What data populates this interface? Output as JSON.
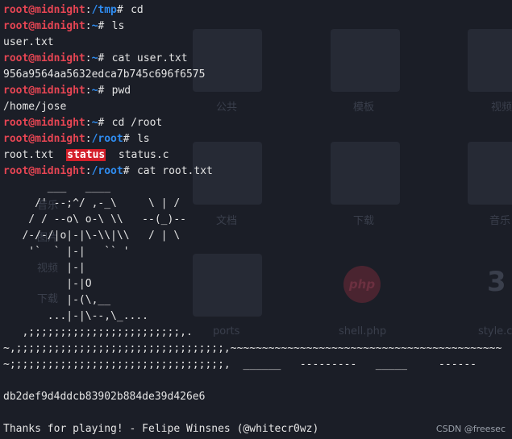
{
  "prompt": {
    "user": "root@midnight",
    "colon": ":",
    "symbol": "#"
  },
  "paths": {
    "tmp": "/tmp",
    "home": "~",
    "root": "/root"
  },
  "commands": {
    "cd": "cd",
    "ls": "ls",
    "cat_user": "cat user.txt",
    "pwd": "pwd",
    "cd_root": "cd /root",
    "cat_root": "cat root.txt"
  },
  "outputs": {
    "ls_home": "user.txt",
    "user_hash": "956a9564aa5632edca7b745c696f6575",
    "pwd": "/home/jose",
    "root_txt": "root.txt",
    "status": "status",
    "status_c": "status.c"
  },
  "ascii_art": [
    "       ___   ____",
    "     /' --;^/ ,-_\\     \\ | /",
    "    / / --o\\ o-\\ \\\\   --(_)--",
    "   /-/-/|o|-|\\-\\\\|\\\\   / | \\",
    "    '`  ` |-|   `` '",
    "          |-|",
    "          |-|O",
    "          |-(\\,__",
    "       ...|-|\\--,\\_....",
    "   ,;;;;;;;;;;;;;;;;;;;;;;;;,.",
    "~,;;;;;;;;;;;;;;;;;;;;;;;;;;;;;;;;;,~~~~~~~~~~~~~~~~~~~~~~~~~~~~~~~~~~~~~~~~~~~",
    "~;;;;;;;;;;;;;;;;;;;;;;;;;;;;;;;;;;,  ______   ---------   _____     ------"
  ],
  "root_hash": "db2def9d4ddcb83902b884de39d426e6",
  "thanks": "Thanks for playing! - Felipe Winsnes (@whitecr0wz)",
  "background": {
    "labels": [
      "公共",
      "模板",
      "视频",
      "文档",
      "下载",
      "音乐",
      "音乐",
      "图片",
      "视频",
      "下载",
      "ports",
      "shell.php",
      "style.css"
    ],
    "badge": "php",
    "number": "3"
  },
  "watermark": "CSDN @freesec"
}
